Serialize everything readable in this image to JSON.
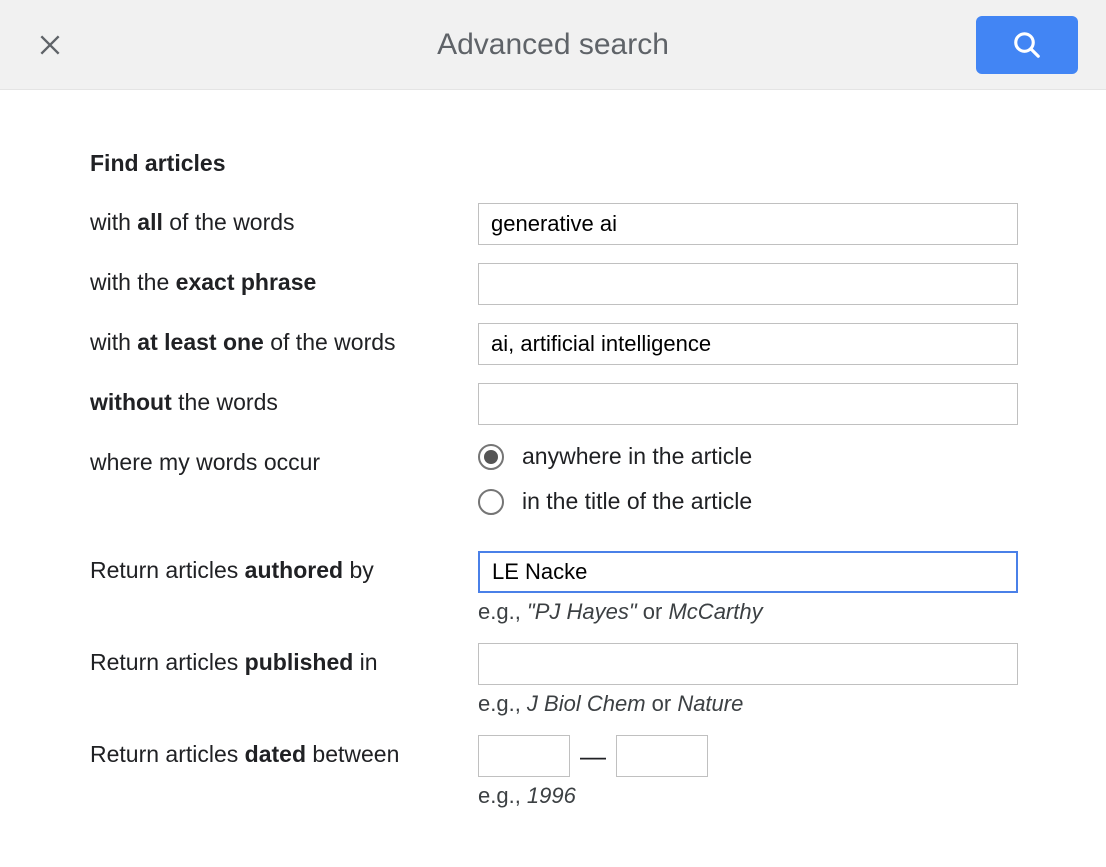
{
  "header": {
    "title": "Advanced search"
  },
  "section_title": "Find articles",
  "rows": {
    "all_words": {
      "value": "generative ai"
    },
    "exact_phrase": {
      "value": ""
    },
    "at_least_one": {
      "value": "ai, artificial intelligence"
    },
    "without_words": {
      "value": ""
    },
    "occur": {
      "anywhere_label": "anywhere in the article",
      "title_label": "in the title of the article",
      "selected": "anywhere"
    },
    "authored": {
      "value": "LE Nacke",
      "hint_prefix": "e.g., ",
      "hint_quoted": "\"PJ Hayes\"",
      "hint_or": " or ",
      "hint_plain": "McCarthy"
    },
    "published": {
      "value": "",
      "hint_prefix": "e.g., ",
      "hint_j1": "J Biol Chem",
      "hint_or": " or ",
      "hint_j2": "Nature"
    },
    "dated": {
      "from": "",
      "to": "",
      "dash": "—",
      "hint_prefix": "e.g., ",
      "hint_year": "1996"
    }
  },
  "labels": {
    "all_pre": "with ",
    "all_b": "all",
    "all_post": " of the words",
    "exact_pre": "with the ",
    "exact_b": "exact phrase",
    "one_pre": "with ",
    "one_b": "at least one",
    "one_post": " of the words",
    "without_b": "without",
    "without_post": " the words",
    "occur": "where my words occur",
    "auth_pre": "Return articles ",
    "auth_b": "authored",
    "auth_post": " by",
    "pub_pre": "Return articles ",
    "pub_b": "published",
    "pub_post": " in",
    "date_pre": "Return articles ",
    "date_b": "dated",
    "date_post": " between"
  }
}
